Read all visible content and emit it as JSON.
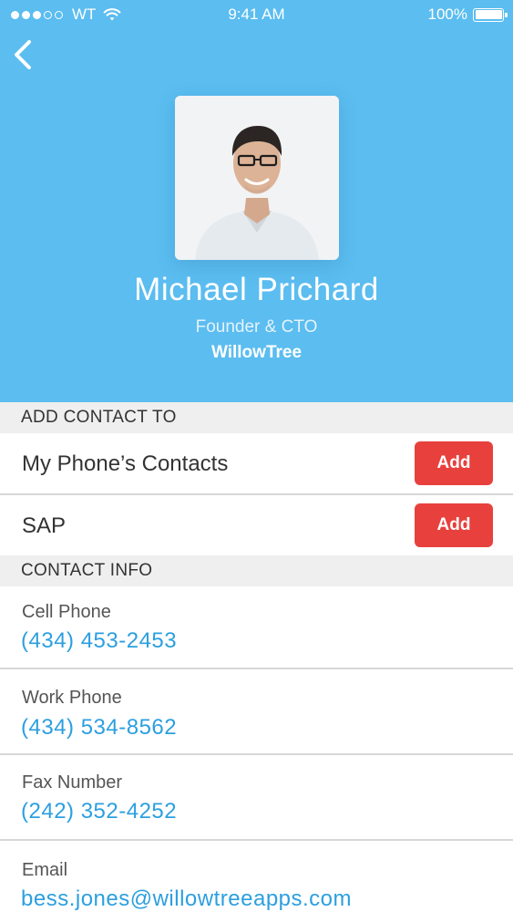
{
  "status_bar": {
    "carrier": "WT",
    "time": "9:41 AM",
    "battery": "100%",
    "signal_dots_filled": 3,
    "signal_dots_total": 5
  },
  "profile": {
    "name": "Michael Prichard",
    "title": "Founder & CTO",
    "company": "WillowTree"
  },
  "add_contact": {
    "section_title": "ADD CONTACT TO",
    "rows": [
      {
        "label": "My Phone’s Contacts",
        "button": "Add"
      },
      {
        "label": "SAP",
        "button": "Add"
      }
    ]
  },
  "contact_info": {
    "section_title": "CONTACT INFO",
    "fields": [
      {
        "label": "Cell Phone",
        "value": "(434) 453-2453"
      },
      {
        "label": "Work Phone",
        "value": "(434) 534-8562"
      },
      {
        "label": "Fax Number",
        "value": "(242) 352-4252"
      },
      {
        "label": "Email",
        "value": "bess.jones@willowtreeapps.com"
      }
    ]
  },
  "colors": {
    "header_bg": "#5bbdf0",
    "accent_red": "#e8413d",
    "link_blue": "#2c9fe0",
    "section_bg": "#efefef"
  },
  "icons": [
    "back-chevron-icon",
    "wifi-icon",
    "battery-icon"
  ]
}
